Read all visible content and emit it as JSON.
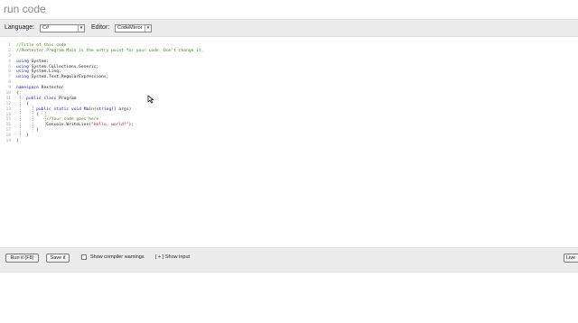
{
  "page": {
    "title": "run code"
  },
  "toolbar": {
    "language_label": "Language:",
    "language_value": "C#",
    "editor_label": "Editor:",
    "editor_value": "CodeMirror"
  },
  "editor": {
    "line_numbers": [
      "1",
      "2",
      "3",
      "4",
      "5",
      "6",
      "7",
      "8",
      "9",
      "10",
      "11",
      "12",
      "13",
      "14",
      "15",
      "16",
      "17",
      "18",
      "19"
    ],
    "lines": [
      {
        "segments": [
          {
            "type": "comment",
            "text": "//Title of this code"
          }
        ]
      },
      {
        "segments": [
          {
            "type": "comment",
            "text": "//Rextester.Program.Main is the entry point for your code. Don't change it."
          }
        ]
      },
      {
        "segments": [
          {
            "type": "plain",
            "text": ""
          }
        ]
      },
      {
        "segments": [
          {
            "type": "keyword",
            "text": "using"
          },
          {
            "type": "plain",
            "text": " System;"
          }
        ]
      },
      {
        "segments": [
          {
            "type": "keyword",
            "text": "using"
          },
          {
            "type": "plain",
            "text": " System.Collections.Generic;"
          }
        ]
      },
      {
        "segments": [
          {
            "type": "keyword",
            "text": "using"
          },
          {
            "type": "plain",
            "text": " System.Linq;"
          }
        ]
      },
      {
        "segments": [
          {
            "type": "keyword",
            "text": "using"
          },
          {
            "type": "plain",
            "text": " System.Text.RegularExpressions;"
          }
        ]
      },
      {
        "segments": [
          {
            "type": "plain",
            "text": ""
          }
        ]
      },
      {
        "segments": [
          {
            "type": "keyword",
            "text": "namespace"
          },
          {
            "type": "plain",
            "text": " Rextester"
          }
        ]
      },
      {
        "segments": [
          {
            "type": "plain",
            "text": "{"
          }
        ]
      },
      {
        "segments": [
          {
            "type": "plain",
            "text": "    "
          },
          {
            "type": "keyword",
            "text": "public"
          },
          {
            "type": "plain",
            "text": " "
          },
          {
            "type": "keyword",
            "text": "class"
          },
          {
            "type": "plain",
            "text": " Program"
          }
        ]
      },
      {
        "segments": [
          {
            "type": "plain",
            "text": "    {"
          }
        ]
      },
      {
        "segments": [
          {
            "type": "plain",
            "text": "        "
          },
          {
            "type": "keyword",
            "text": "public"
          },
          {
            "type": "plain",
            "text": " "
          },
          {
            "type": "keyword",
            "text": "static"
          },
          {
            "type": "plain",
            "text": " "
          },
          {
            "type": "keyword",
            "text": "void"
          },
          {
            "type": "plain",
            "text": " Main("
          },
          {
            "type": "keyword",
            "text": "string"
          },
          {
            "type": "plain",
            "text": "[] args)"
          }
        ]
      },
      {
        "segments": [
          {
            "type": "plain",
            "text": "        {"
          }
        ]
      },
      {
        "segments": [
          {
            "type": "plain",
            "text": "            "
          },
          {
            "type": "comment",
            "text": "//Your code goes here"
          }
        ]
      },
      {
        "segments": [
          {
            "type": "plain",
            "text": "            Console.WriteLine("
          },
          {
            "type": "string",
            "text": "\"Hello, world!\""
          },
          {
            "type": "plain",
            "text": ");"
          }
        ]
      },
      {
        "segments": [
          {
            "type": "plain",
            "text": "        }"
          }
        ]
      },
      {
        "segments": [
          {
            "type": "plain",
            "text": "    }"
          }
        ]
      },
      {
        "segments": [
          {
            "type": "plain",
            "text": "}"
          }
        ]
      }
    ]
  },
  "bottom": {
    "run_label": "Run it (F8)",
    "save_label": "Save it",
    "warnings_label": "Show compiler warnings",
    "show_input_label": "[ + ] Show input",
    "live_label": "Live"
  },
  "colors": {
    "comment": "#4a7a2a",
    "keyword": "#1a1aa6",
    "string": "#b22a2a",
    "toolbar_bg": "#ececec"
  }
}
